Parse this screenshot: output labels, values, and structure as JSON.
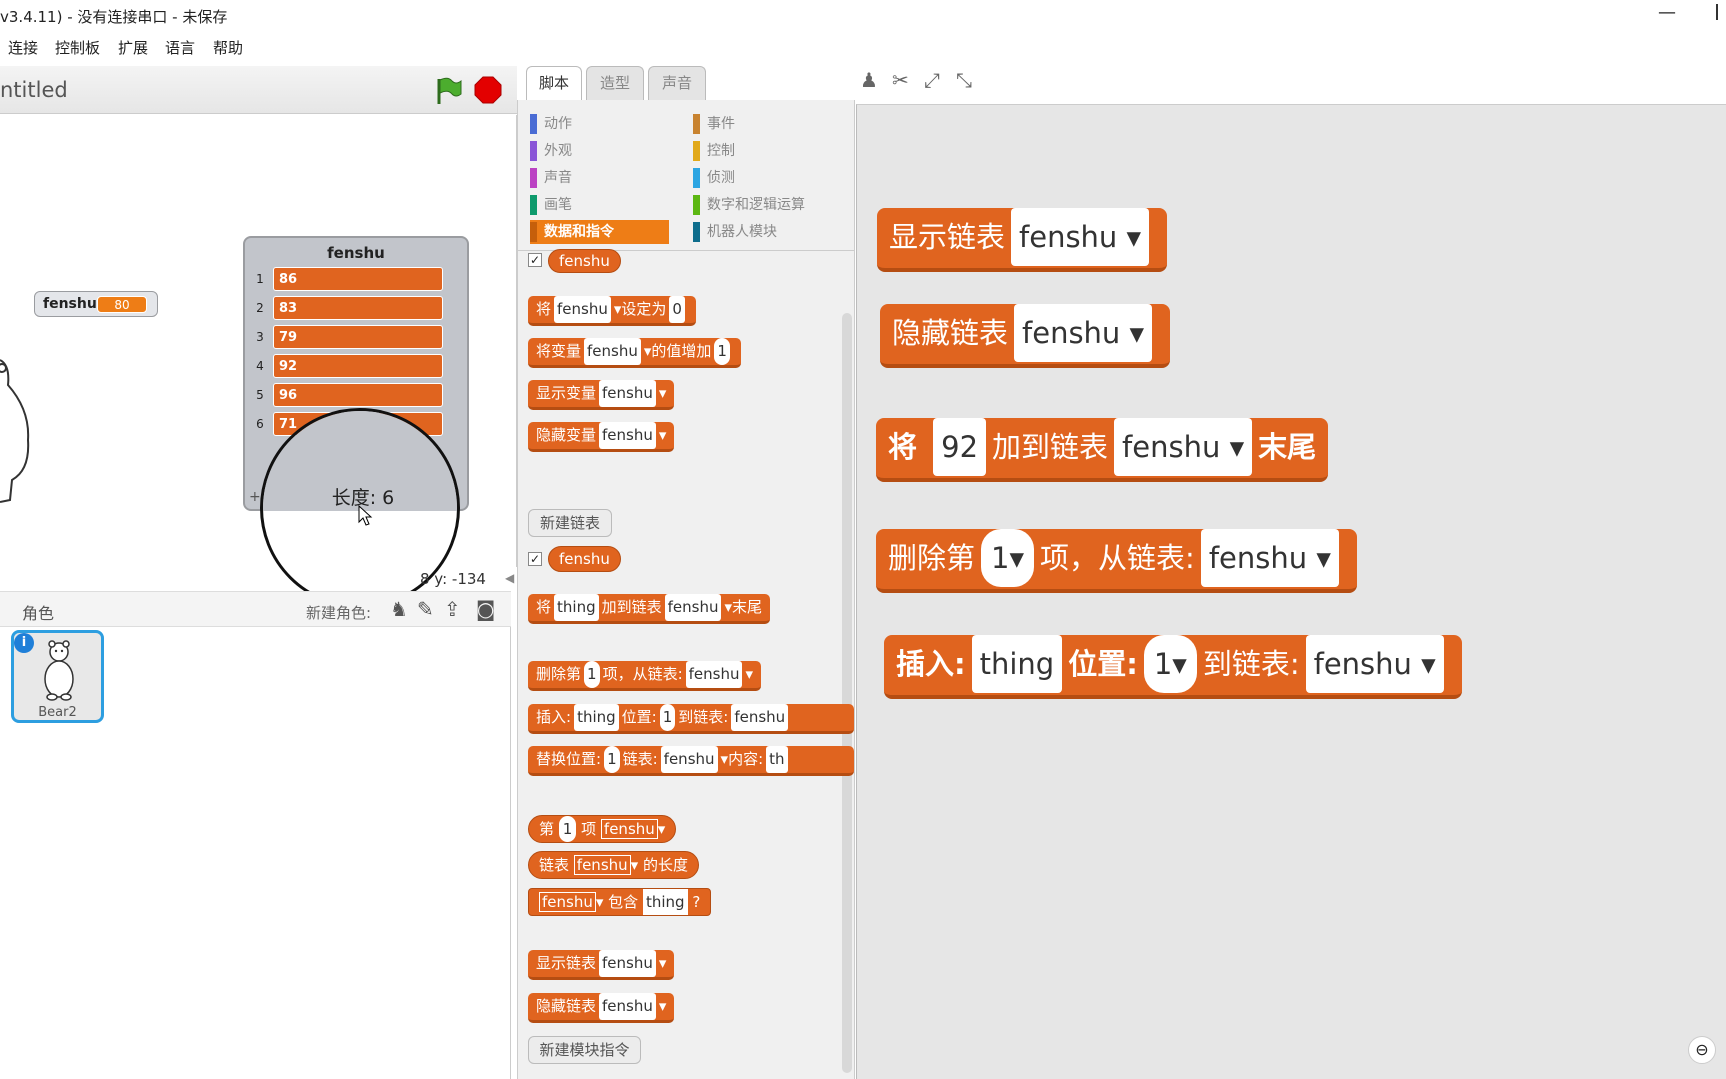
{
  "window": {
    "title": "v3.4.11) - 没有连接串口 - 未保存",
    "minimize": "—"
  },
  "menu": [
    "连接",
    "控制板",
    "扩展",
    "语言",
    "帮助"
  ],
  "stage": {
    "title": "ntitled",
    "variable": {
      "name": "fenshu",
      "value": "80"
    },
    "list": {
      "title": "fenshu",
      "items": [
        {
          "idx": "1",
          "val": "86"
        },
        {
          "idx": "2",
          "val": "83"
        },
        {
          "idx": "3",
          "val": "79"
        },
        {
          "idx": "4",
          "val": "92"
        },
        {
          "idx": "5",
          "val": "96"
        },
        {
          "idx": "6",
          "val": "71"
        }
      ],
      "length_label": "长度: 6",
      "add": "+"
    },
    "coords": "8  y: -134"
  },
  "sprites": {
    "header": "角色",
    "new_label": "新建角色:",
    "selected": "Bear2"
  },
  "tabs": [
    "脚本",
    "造型",
    "声音"
  ],
  "categories_left": [
    {
      "label": "动作",
      "color": "#4a6cd4"
    },
    {
      "label": "外观",
      "color": "#8a55d7"
    },
    {
      "label": "声音",
      "color": "#bb42c3"
    },
    {
      "label": "画笔",
      "color": "#0e9a6c"
    },
    {
      "label": "数据和指令",
      "color": "#ee7d16"
    }
  ],
  "categories_right": [
    {
      "label": "事件",
      "color": "#c88330"
    },
    {
      "label": "控制",
      "color": "#e1a91a"
    },
    {
      "label": "侦测",
      "color": "#2ca5e2"
    },
    {
      "label": "数字和逻辑运算",
      "color": "#5cb712"
    },
    {
      "label": "机器人模块",
      "color": "#0e6d8c"
    }
  ],
  "palette": {
    "var_reporter": "fenshu",
    "set": {
      "a": "将",
      "var": "fenshu",
      "b": "设定为",
      "val": "0"
    },
    "change": {
      "a": "将变量",
      "var": "fenshu",
      "b": "的值增加",
      "val": "1"
    },
    "showvar": {
      "a": "显示变量",
      "var": "fenshu"
    },
    "hidevar": {
      "a": "隐藏变量",
      "var": "fenshu"
    },
    "new_list": "新建链表",
    "list_reporter": "fenshu",
    "add": {
      "a": "将",
      "thing": "thing",
      "b": "加到链表",
      "list": "fenshu",
      "c": "末尾"
    },
    "delete": {
      "a": "删除第",
      "n": "1",
      "b": "项，从链表:",
      "list": "fenshu"
    },
    "insert": {
      "a": "插入:",
      "thing": "thing",
      "b": "位置:",
      "n": "1",
      "c": "到链表:",
      "list": "fenshu"
    },
    "replace": {
      "a": "替换位置:",
      "n": "1",
      "b": "链表:",
      "list": "fenshu",
      "c": "内容:",
      "thing": "th"
    },
    "item": {
      "a": "第",
      "n": "1",
      "b": "项",
      "list": "fenshu"
    },
    "length": {
      "a": "链表",
      "list": "fenshu",
      "b": "的长度"
    },
    "contains": {
      "list": "fenshu",
      "a": "包含",
      "thing": "thing",
      "q": "?"
    },
    "showlist": {
      "a": "显示链表",
      "list": "fenshu"
    },
    "hidelist": {
      "a": "隐藏链表",
      "list": "fenshu"
    },
    "new_block": "新建模块指令"
  },
  "script": {
    "show": {
      "a": "显示链表",
      "list": "fenshu"
    },
    "hide": {
      "a": "隐藏链表",
      "list": "fenshu"
    },
    "add": {
      "a": "将",
      "val": "92",
      "b": "加到链表",
      "list": "fenshu",
      "c": "末尾"
    },
    "delete": {
      "a": "删除第",
      "n": "1",
      "b": "项，从链表:",
      "list": "fenshu"
    },
    "insert": {
      "a": "插入:",
      "thing": "thing",
      "b": "位置:",
      "n": "1",
      "c": "到链表:",
      "list": "fenshu"
    }
  }
}
